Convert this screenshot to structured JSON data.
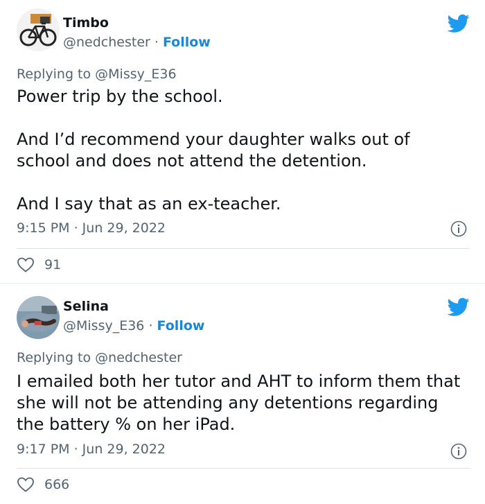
{
  "colors": {
    "text": "#0f1419",
    "secondary": "#536471",
    "link": "#1b86d3",
    "twitter_blue": "#1d9bf0"
  },
  "tweets": [
    {
      "name": "Timbo",
      "handle": "@nedchester",
      "separator": "·",
      "follow_label": "Follow",
      "replying_to": "Replying to @Missy_E36",
      "paragraphs": [
        "Power trip by the school.",
        "And I’d recommend your daughter walks out of school and does not attend the detention.",
        "And I say that as an ex-teacher."
      ],
      "timestamp": "9:15 PM · Jun 29, 2022",
      "likes": "91",
      "avatar_icon": "bicycle-avatar"
    },
    {
      "name": "Selina",
      "handle": "@Missy_E36",
      "separator": "·",
      "follow_label": "Follow",
      "replying_to": "Replying to @nedchester",
      "paragraphs": [
        "I emailed both her tutor and AHT to inform them that she will not be attending any detentions regarding the battery % on her iPad."
      ],
      "timestamp": "9:17 PM · Jun 29, 2022",
      "likes": "666",
      "avatar_icon": "reclining-person-avatar"
    }
  ]
}
